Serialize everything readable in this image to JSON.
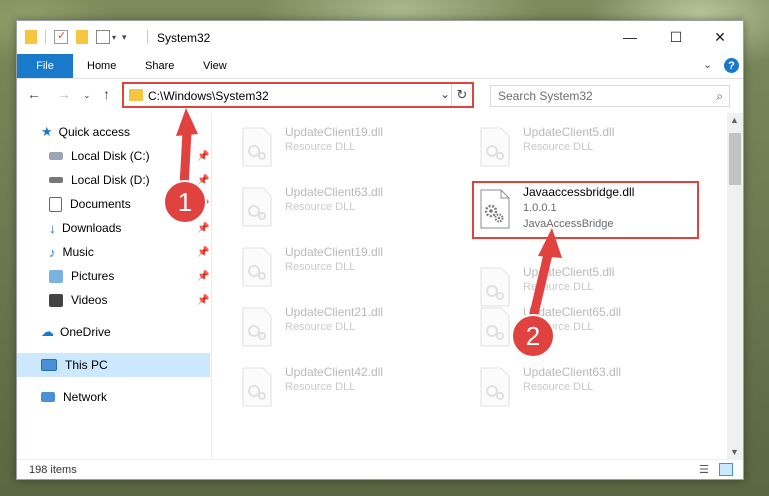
{
  "window": {
    "title": "System32",
    "minimize": "—",
    "maximize": "☐",
    "close": "✕"
  },
  "ribbon": {
    "file": "File",
    "home": "Home",
    "share": "Share",
    "view": "View",
    "help": "?"
  },
  "address": {
    "path": "C:\\Windows\\System32",
    "search_placeholder": "Search System32"
  },
  "nav": {
    "items": [
      {
        "label": "Quick access",
        "icon": "star-icon"
      },
      {
        "label": "Local Disk (C:)",
        "icon": "drive-icon"
      },
      {
        "label": "Local Disk (D:)",
        "icon": "drive-icon"
      },
      {
        "label": "Documents",
        "icon": "documents-icon"
      },
      {
        "label": "Downloads",
        "icon": "downloads-icon"
      },
      {
        "label": "Music",
        "icon": "music-icon"
      },
      {
        "label": "Pictures",
        "icon": "pictures-icon"
      },
      {
        "label": "Videos",
        "icon": "videos-icon"
      },
      {
        "label": "OneDrive",
        "icon": "onedrive-icon"
      },
      {
        "label": "This PC",
        "icon": "pc-icon"
      },
      {
        "label": "Network",
        "icon": "network-icon"
      }
    ]
  },
  "files": {
    "left": [
      {
        "name": "UpdateClient19.dll",
        "sub": "Resource DLL"
      },
      {
        "name": "UpdateClient63.dll",
        "sub": "Resource DLL"
      },
      {
        "name": "UpdateClient19.dll",
        "sub": "Resource DLL"
      },
      {
        "name": "UpdateClient21.dll",
        "sub": "Resource DLL"
      },
      {
        "name": "UpdateClient42.dll",
        "sub": "Resource DLL"
      }
    ],
    "right": [
      {
        "name": "UpdateClient5.dll",
        "sub": "Resource DLL"
      },
      {
        "name": "Javaaccessbridge.dll",
        "version": "1.0.0.1",
        "sub": "JavaAccessBridge"
      },
      {
        "name": "UpdateClient5.dll",
        "sub": "Resource DLL"
      },
      {
        "name": "UpdateClient65.dll",
        "sub": "Resource DLL"
      },
      {
        "name": "UpdateClient63.dll",
        "sub": "Resource DLL"
      }
    ]
  },
  "status": {
    "count": "198 items"
  },
  "annotations": {
    "step1": "1",
    "step2": "2"
  },
  "colors": {
    "accent": "#1979ca",
    "annotation_red": "#e0423f",
    "selection": "#cce8ff"
  }
}
